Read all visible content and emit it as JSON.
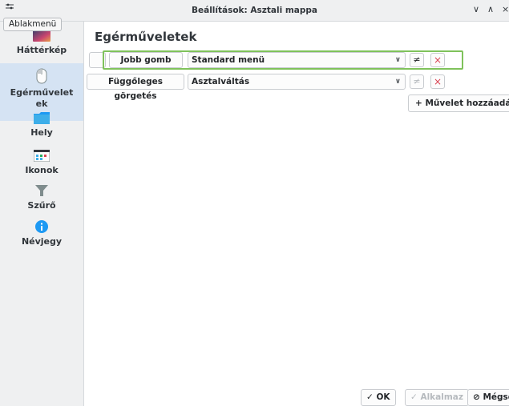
{
  "window": {
    "title": "Beállítások: Asztali mappa",
    "tooltip": "Ablakmenü",
    "controls": {
      "minimize": "∨",
      "maximize": "∧",
      "close": "×"
    }
  },
  "sidebar": {
    "items": [
      {
        "label": "Háttérkép",
        "icon": "wallpaper-icon"
      },
      {
        "label": "Egérműveletek",
        "line1": "Egérművelet",
        "line2": "ek",
        "icon": "mouse-icon",
        "active": true
      },
      {
        "label": "Hely",
        "icon": "folder-icon"
      },
      {
        "label": "Ikonok",
        "icon": "icons-grid-icon"
      },
      {
        "label": "Szűrő",
        "icon": "filter-icon"
      },
      {
        "label": "Névjegy",
        "icon": "info-icon"
      }
    ]
  },
  "main": {
    "title": "Egérműveletek",
    "rows": [
      {
        "trigger": "Jobb gomb",
        "action": "Standard menü",
        "configure_enabled": true
      },
      {
        "trigger": "Függőleges görgetés",
        "action": "Asztalváltás",
        "configure_enabled": false
      }
    ],
    "add_button": "+ Művelet hozzáadása",
    "icons": {
      "configure": "≠",
      "remove": "×",
      "dropdown": "∨"
    }
  },
  "footer": {
    "ok": "✓ OK",
    "apply": "✓ Alkalmaz",
    "cancel": "⊘ Mégse"
  },
  "colors": {
    "highlight": "#7fc25b",
    "accent": "#3daee9",
    "remove": "#da4453",
    "sidebar_bg": "#eff0f1",
    "active_item": "#d5e3f3"
  }
}
